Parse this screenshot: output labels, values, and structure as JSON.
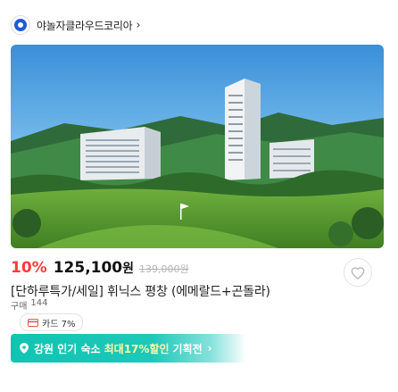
{
  "seller": {
    "name": "야놀자클라우드코리아",
    "arrow": "›",
    "logo_icon": "yanolja-cloud-logo-icon"
  },
  "hero": {
    "image": "resort-hotel-golf-course-photo"
  },
  "product": {
    "discount": "10%",
    "price": "125,100",
    "price_unit": "원",
    "original_price": "139,000원",
    "title": "[단하루특가/세일] 휘닉스 평창 (에메랄드+곤돌라)",
    "sold_label": "구매",
    "sold_count": "144",
    "heart_icon": "heart-outline-icon"
  },
  "card_badge": {
    "label": "카드 7%",
    "icon": "card-icon"
  },
  "promo": {
    "icon": "location-pin-icon",
    "text_before": "강원 인기 숙소",
    "highlight": "최대17%할인",
    "text_after": "기획전",
    "chevron": "›",
    "colors": {
      "start": "#11c4b2",
      "highlight": "#fff7a8"
    }
  }
}
